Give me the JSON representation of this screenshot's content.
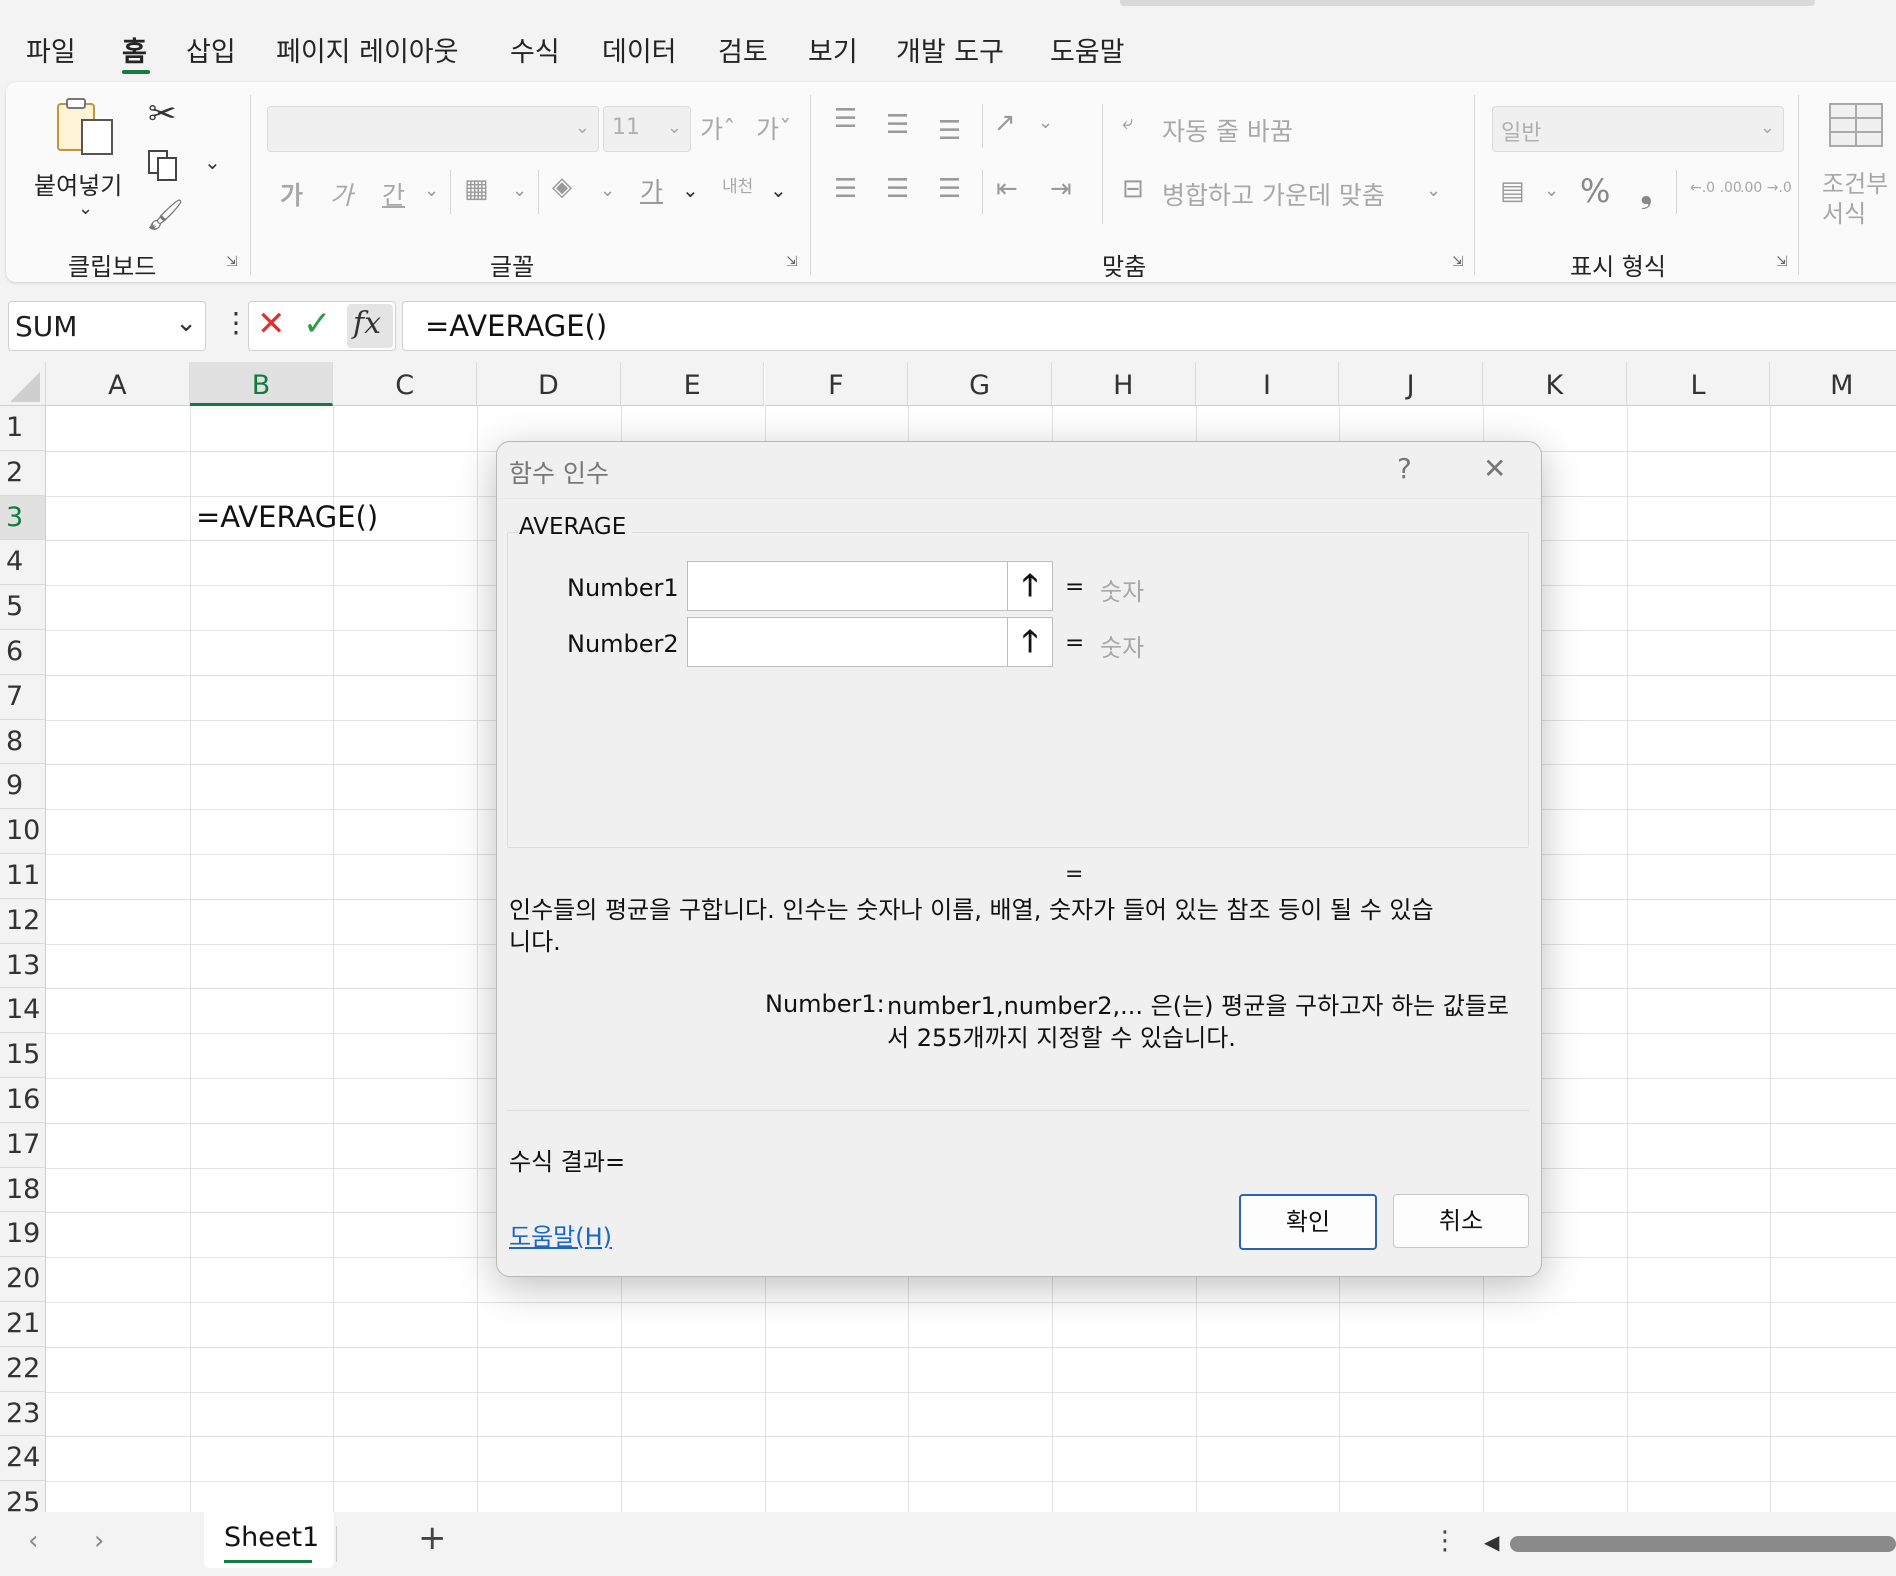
{
  "menu": {
    "tabs": [
      "파일",
      "홈",
      "삽입",
      "페이지 레이아웃",
      "수식",
      "데이터",
      "검토",
      "보기",
      "개발 도구",
      "도움말"
    ],
    "active_index": 1
  },
  "ribbon": {
    "clipboard": {
      "label": "클립보드",
      "paste_label": "붙여넣기"
    },
    "font": {
      "label": "글꼴",
      "font_size": "11",
      "bold": "가",
      "italic": "가",
      "underline": "간",
      "grow": "가ˆ",
      "shrink": "가ˇ",
      "font_color": "가",
      "phonetic": "내천"
    },
    "alignment": {
      "label": "맞춤",
      "wrap_text": "자동 줄 바꿈",
      "merge_center": "병합하고 가운데 맞춤"
    },
    "number": {
      "label": "표시 형식",
      "format": "일반",
      "percent": "%",
      "comma": "❟",
      "inc_decimal": "←.0 .00",
      "dec_decimal": ".00 →.0"
    },
    "styles": {
      "conditional_line1": "조건부",
      "conditional_line2": "서식"
    }
  },
  "formula_bar": {
    "name_box": "SUM",
    "fx": "fx",
    "formula": "=AVERAGE()"
  },
  "grid": {
    "columns": [
      "A",
      "B",
      "C",
      "D",
      "E",
      "F",
      "G",
      "H",
      "I",
      "J",
      "K",
      "L",
      "M"
    ],
    "rows": [
      "1",
      "2",
      "3",
      "4",
      "5",
      "6",
      "7",
      "8",
      "9",
      "10",
      "11",
      "12",
      "13",
      "14",
      "15",
      "16",
      "17",
      "18",
      "19",
      "20",
      "21",
      "22",
      "23",
      "24",
      "25"
    ],
    "selected_column": "B",
    "selected_row": "3",
    "active_cell_text": "=AVERAGE()"
  },
  "sheets": {
    "tabs": [
      "Sheet1"
    ],
    "add": "+"
  },
  "dialog": {
    "title": "함수 인수",
    "help_glyph": "?",
    "close_glyph": "✕",
    "function_name": "AVERAGE",
    "args": [
      {
        "label": "Number1",
        "value": "",
        "eq": "=",
        "result": "숫자"
      },
      {
        "label": "Number2",
        "value": "",
        "eq": "=",
        "result": "숫자"
      }
    ],
    "result_eq": "=",
    "description": "인수들의 평균을 구합니다. 인수는 숫자나 이름, 배열, 숫자가 들어 있는 참조 등이 될 수 있습니다.",
    "arg_help_label": "Number1:",
    "arg_help_text": "number1,number2,... 은(는) 평균을 구하고자 하는 값들로서 255개까지 지정할 수 있습니다.",
    "formula_result": "수식 결과=",
    "help_link": "도움말(H)",
    "ok": "확인",
    "cancel": "취소"
  },
  "colors": {
    "accent": "#107c41",
    "link": "#1a66c9",
    "cancel_x": "#e03030",
    "enter_check": "#2e9b48"
  }
}
